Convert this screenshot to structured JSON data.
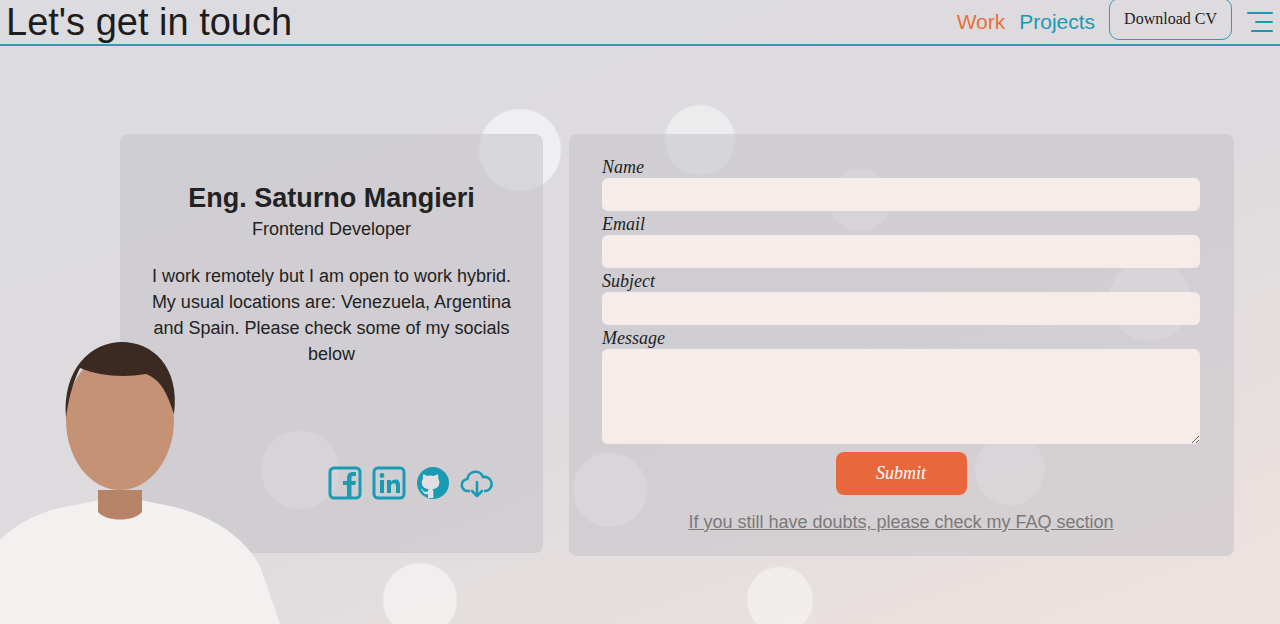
{
  "header": {
    "title": "Let's get in touch",
    "nav": [
      {
        "label": "Work",
        "color": "#e8703a"
      },
      {
        "label": "Projects",
        "color": "#1b9ab3"
      }
    ],
    "button": "Download CV"
  },
  "profile": {
    "name": "Eng. Saturno Mangieri",
    "role": "Frontend Developer",
    "bio": "I work remotely but I am open to work hybrid. My usual locations are: Venezuela, Argentina and Spain. Please check some of my socials below"
  },
  "form": {
    "fields": [
      {
        "label": "Name",
        "kind": "input"
      },
      {
        "label": "Email",
        "kind": "input"
      },
      {
        "label": "Subject",
        "kind": "input"
      },
      {
        "label": "Message",
        "kind": "textarea"
      }
    ],
    "submit": "Submit",
    "faq": "If you still have doubts, please check my FAQ section"
  }
}
